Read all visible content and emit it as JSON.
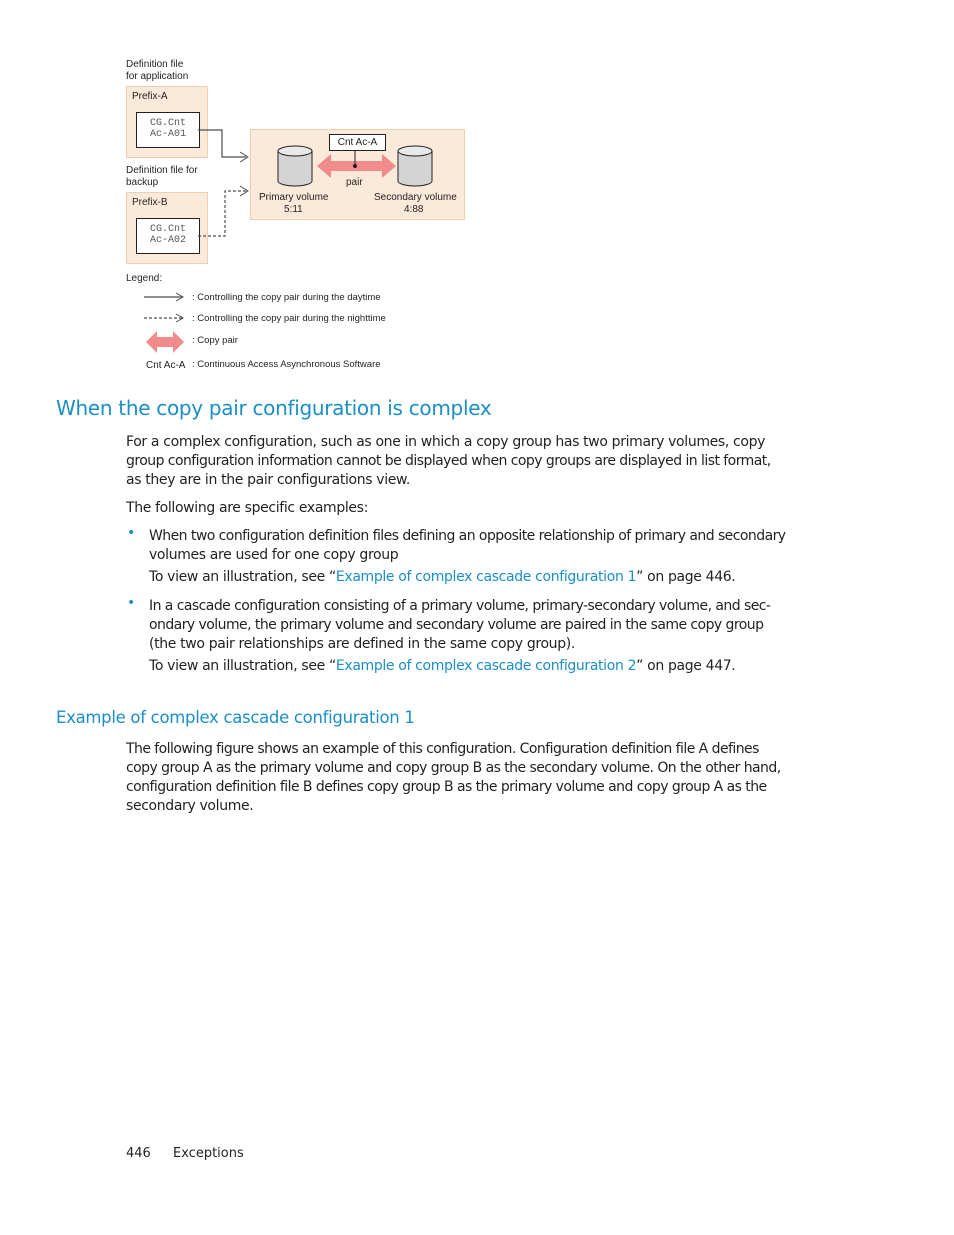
{
  "diagram": {
    "def_app_label_line1": "Definition file",
    "def_app_label_line2": "for application",
    "prefix_a": "Prefix-A",
    "cg_a_line1": "CG.Cnt",
    "cg_a_line2": "Ac-A01",
    "def_backup_label_line1": "Definition file for",
    "def_backup_label_line2": "backup",
    "prefix_b": "Prefix-B",
    "cg_b_line1": "CG.Cnt",
    "cg_b_line2": "Ac-A02",
    "cnt_label": "Cnt Ac-A",
    "pair_label": "pair",
    "primary_label": "Primary volume",
    "primary_id": "5:11",
    "secondary_label": "Secondary volume",
    "secondary_id": "4:88",
    "colors": {
      "prefix_fill": "#fbe9d9",
      "prefix_border": "#f0cfae",
      "pair_arrow": "#f28b8b"
    }
  },
  "legend": {
    "title": "Legend:",
    "items": [
      {
        "symbol": "solid-arrow",
        "text": ": Controlling the copy pair during the daytime"
      },
      {
        "symbol": "dashed-arrow",
        "text": ": Controlling the copy pair during the nighttime"
      },
      {
        "symbol": "double-arrow",
        "text": ": Copy pair"
      },
      {
        "symbol": "Cnt Ac-A",
        "text": ": Continuous Access Asynchronous Software"
      }
    ]
  },
  "section1": {
    "heading": "When the copy pair configuration is complex",
    "para1_line1": "For a complex configuration, such as one in which a copy group has two primary volumes, copy",
    "para1_line2": "group configuration information cannot be displayed when copy groups are displayed in list format,",
    "para1_line3": "as they are in the pair configurations view.",
    "para2": "The following are specific examples:",
    "bullets": [
      {
        "line1": "When two configuration definition files defining an opposite relationship of primary and secondary",
        "line2": "volumes are used for one copy group",
        "ref_prefix": "To view an illustration, see “",
        "ref_link": "Example of complex cascade configuration 1",
        "ref_suffix": "” on page 446."
      },
      {
        "line1": "In a cascade configuration consisting of a primary volume, primary-secondary volume, and sec-",
        "line2": "ondary volume, the primary volume and secondary volume are paired in the same copy group",
        "line3": "(the two pair relationships are defined in the same copy group).",
        "ref_prefix": "To view an illustration, see “",
        "ref_link": "Example of complex cascade configuration 2",
        "ref_suffix": "” on page 447."
      }
    ]
  },
  "section2": {
    "heading": "Example of complex cascade configuration 1",
    "para_line1": "The following figure shows an example of this configuration. Configuration definition file A defines",
    "para_line2": "copy group A as the primary volume and copy group B as the secondary volume. On the other hand,",
    "para_line3": "configuration definition file B defines copy group B as the primary volume and copy group A as the",
    "para_line4": "secondary volume."
  },
  "footer": {
    "page_number": "446",
    "section": "Exceptions"
  },
  "colors": {
    "heading": "#1a8fc6",
    "link": "#1a8fc6",
    "text": "#231f20"
  }
}
